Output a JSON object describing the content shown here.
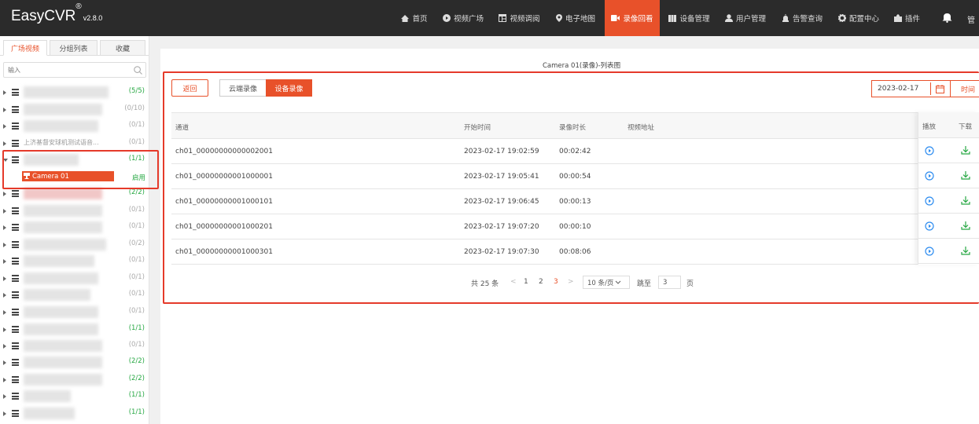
{
  "app": {
    "name": "EasyCVR",
    "mark": "®",
    "version": "v2.8.0"
  },
  "nav": {
    "items": [
      {
        "label": "首页",
        "icon": "home-icon"
      },
      {
        "label": "视频广场",
        "icon": "video-square-icon"
      },
      {
        "label": "视频调阅",
        "icon": "video-grid-icon"
      },
      {
        "label": "电子地图",
        "icon": "map-pin-icon"
      },
      {
        "label": "录像回看",
        "icon": "camera-icon",
        "active": true
      },
      {
        "label": "设备管理",
        "icon": "device-icon"
      },
      {
        "label": "用户管理",
        "icon": "user-icon"
      },
      {
        "label": "告警查询",
        "icon": "alarm-icon"
      },
      {
        "label": "配置中心",
        "icon": "gear-icon"
      },
      {
        "label": "插件",
        "icon": "puzzle-icon"
      }
    ],
    "right_cut_label": "管",
    "accent_color": "#e8512a"
  },
  "sidebar": {
    "tabs": [
      "广场视频",
      "分组列表",
      "收藏"
    ],
    "search_placeholder": "输入",
    "rows": [
      {
        "count": "(5/5)",
        "status": "green"
      },
      {
        "count": "(0/10)",
        "status": "gray"
      },
      {
        "count": "(0/1)",
        "status": "gray"
      },
      {
        "text": "上济基督安球机测试语音...",
        "count": "(0/1)",
        "status": "gray"
      },
      {
        "count": "(1/1)",
        "status": "green",
        "expanded": true
      },
      {
        "count": "(2/2)",
        "status": "green"
      },
      {
        "count": "(0/1)",
        "status": "gray"
      },
      {
        "count": "(0/1)",
        "status": "gray"
      },
      {
        "count": "(0/2)",
        "status": "gray"
      },
      {
        "count": "(0/1)",
        "status": "gray"
      },
      {
        "count": "(0/1)",
        "status": "gray"
      },
      {
        "count": "(0/1)",
        "status": "gray"
      },
      {
        "count": "(0/1)",
        "status": "gray"
      },
      {
        "count": "(1/1)",
        "status": "green"
      },
      {
        "count": "(0/1)",
        "status": "gray"
      },
      {
        "count": "(2/2)",
        "status": "green"
      },
      {
        "count": "(2/2)",
        "status": "green"
      },
      {
        "count": "(1/1)",
        "status": "green"
      },
      {
        "count": "(1/1)",
        "status": "green"
      }
    ],
    "channel": {
      "name": "Camera 01",
      "state": "启用"
    }
  },
  "main": {
    "title": "Camera 01(录像)-列表图",
    "back_label": "返回",
    "cloud_label": "云端录像",
    "device_label": "设备录像",
    "date": "2023-02-17",
    "time_label": "时间",
    "columns": {
      "channel": "通道",
      "start": "开始时间",
      "duration": "录像时长",
      "url": "视频地址",
      "play": "播放",
      "download": "下载"
    },
    "rows": [
      {
        "channel": "ch01_00000000000002001",
        "start": "2023-02-17 19:02:59",
        "duration": "00:02:42"
      },
      {
        "channel": "ch01_00000000001000001",
        "start": "2023-02-17 19:05:41",
        "duration": "00:00:54"
      },
      {
        "channel": "ch01_00000000001000101",
        "start": "2023-02-17 19:06:45",
        "duration": "00:00:13"
      },
      {
        "channel": "ch01_00000000001000201",
        "start": "2023-02-17 19:07:20",
        "duration": "00:00:10"
      },
      {
        "channel": "ch01_00000000001000301",
        "start": "2023-02-17 19:07:30",
        "duration": "00:08:06"
      }
    ],
    "pagination": {
      "total": "共 25 条",
      "prev": "<",
      "pages": [
        "1",
        "2",
        "3"
      ],
      "current": "3",
      "next": ">",
      "page_size": "10 条/页",
      "jump_label": "跳至",
      "jump_value": "3",
      "page_unit": "页"
    }
  }
}
